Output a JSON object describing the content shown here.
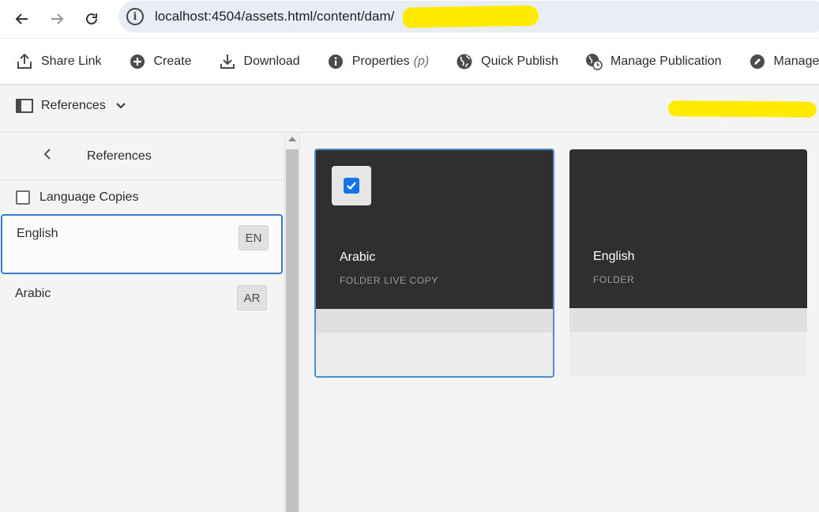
{
  "browser": {
    "back_icon": "arrow-left-icon",
    "forward_icon": "arrow-right-icon",
    "reload_icon": "reload-icon",
    "url": "localhost:4504/assets.html/content/dam/"
  },
  "actions": [
    {
      "label": "Share Link",
      "icon": "share-icon"
    },
    {
      "label": "Create",
      "icon": "plus-circle-icon"
    },
    {
      "label": "Download",
      "icon": "download-icon"
    },
    {
      "label": "Properties",
      "shortcut": "(p)",
      "icon": "info-icon"
    },
    {
      "label": "Quick Publish",
      "icon": "globe-icon"
    },
    {
      "label": "Manage Publication",
      "icon": "globe-clock-icon"
    },
    {
      "label": "Manage T",
      "icon": "edit-icon"
    }
  ],
  "rail_header": {
    "label": "References"
  },
  "rail": {
    "title": "References",
    "language_copies_label": "Language Copies",
    "items": [
      {
        "name": "English",
        "code": "EN",
        "selected": true
      },
      {
        "name": "Arabic",
        "code": "AR",
        "selected": false
      }
    ]
  },
  "cards": [
    {
      "title": "Arabic",
      "subtitle": "FOLDER LIVE COPY",
      "selected": true
    },
    {
      "title": "English",
      "subtitle": "FOLDER",
      "selected": false
    }
  ],
  "colors": {
    "accent": "#1473e6",
    "selection_border": "#4b8fd1",
    "redaction": "#ffeb00"
  }
}
